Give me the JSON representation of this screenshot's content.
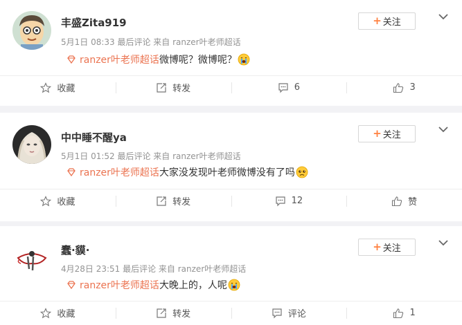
{
  "posts": [
    {
      "username": "丰盛Zita919",
      "meta": "5月1日 08:33 最后评论 来自 ranzer叶老师超话",
      "topic": "ranzer叶老师超话",
      "text": "微博呢？微博呢？",
      "emoji": "crying-emoji",
      "follow_label": "关注",
      "actions": {
        "collect": "收藏",
        "repost": "转发",
        "comment": "6",
        "like": "3"
      }
    },
    {
      "username": "中中睡不醒ya",
      "meta": "5月1日 01:52 最后评论 来自 ranzer叶老师超话",
      "topic": "ranzer叶老师超话",
      "text": "大家没发现叶老师微博没有了吗",
      "emoji": "sad-emoji",
      "follow_label": "关注",
      "actions": {
        "collect": "收藏",
        "repost": "转发",
        "comment": "12",
        "like": "赞"
      }
    },
    {
      "username": "蠢·貘·",
      "meta": "4月28日 23:51 最后评论 来自 ranzer叶老师超话",
      "topic": "ranzer叶老师超话",
      "text": "大晚上的，人呢",
      "emoji": "crying-emoji",
      "follow_label": "关注",
      "actions": {
        "collect": "收藏",
        "repost": "转发",
        "comment": "评论",
        "like": "1"
      }
    }
  ],
  "colors": {
    "topic": "#eb7350",
    "follow_plus": "#ff8140",
    "meta": "#939393",
    "separator": "#f2f2f5"
  }
}
